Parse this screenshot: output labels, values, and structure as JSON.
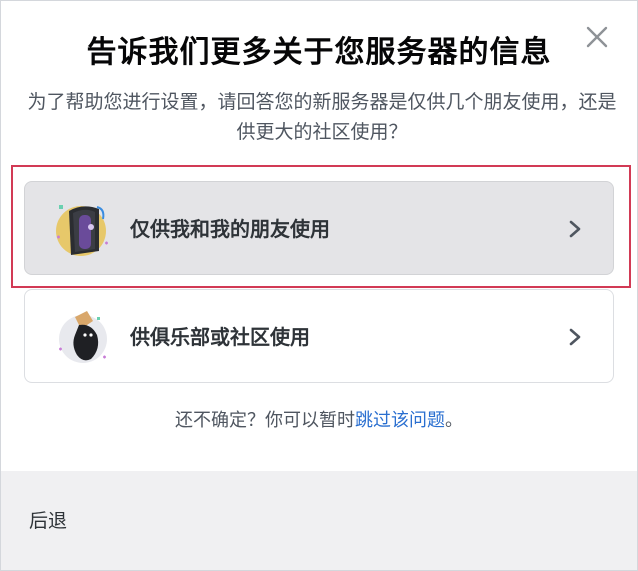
{
  "modal": {
    "title": "告诉我们更多关于您服务器的信息",
    "subtitle": "为了帮助您进行设置，请回答您的新服务器是仅供几个朋友使用，还是供更大的社区使用？",
    "close_icon": "close-icon"
  },
  "options": [
    {
      "label": "仅供我和我的朋友使用",
      "icon": "friends-door-illustration",
      "selected": true
    },
    {
      "label": "供俱乐部或社区使用",
      "icon": "community-illustration",
      "selected": false
    }
  ],
  "unsure": {
    "prefix": "还不确定？你可以暂时",
    "link": "跳过该问题",
    "suffix": "。"
  },
  "footer": {
    "back_label": "后退"
  },
  "colors": {
    "highlight": "#d23a55",
    "link": "#2a6fd0",
    "selected_bg": "#e4e4e7",
    "footer_bg": "#f0f0f2"
  }
}
